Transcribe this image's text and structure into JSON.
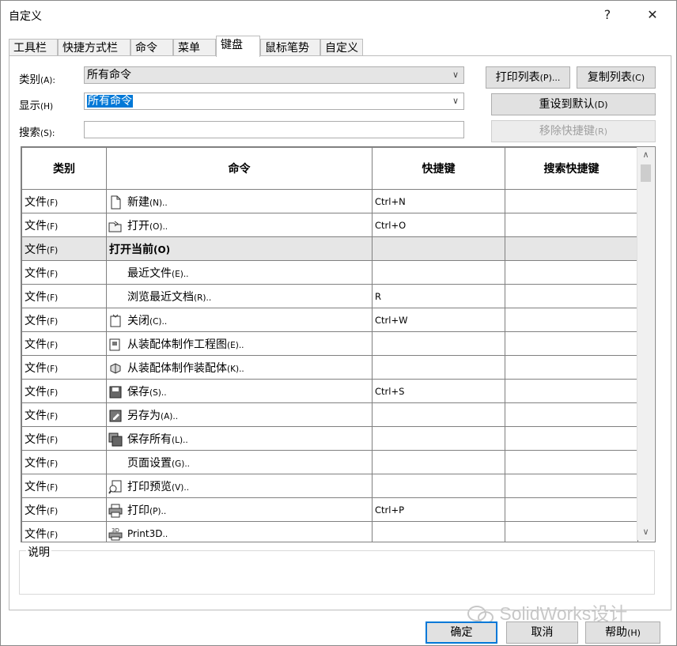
{
  "window": {
    "title": "自定义",
    "help": "?",
    "close": "✕"
  },
  "tabs": [
    "工具栏",
    "快捷方式栏",
    "命令",
    "菜单",
    "键盘",
    "鼠标笔势",
    "自定义"
  ],
  "active_tab": "键盘",
  "filters": {
    "category_label": "类别",
    "category_key": "(A):",
    "category_value": "所有命令",
    "show_label": "显示",
    "show_key": "(H)",
    "show_value": "所有命令",
    "search_label": "搜索",
    "search_key": "(S):",
    "search_value": ""
  },
  "buttons": {
    "print_list": "打印列表",
    "print_list_key": "(P)...",
    "copy_list": "复制列表",
    "copy_list_key": "(C)",
    "reset_default": "重设到默认",
    "reset_default_key": "(D)",
    "remove_shortcut": "移除快捷键",
    "remove_shortcut_key": "(R)",
    "ok": "确定",
    "cancel": "取消",
    "help": "帮助",
    "help_key": "(H)"
  },
  "columns": [
    "类别",
    "命令",
    "快捷键",
    "搜索快捷键"
  ],
  "rows": [
    {
      "cat": "文件",
      "catkey": "(F)",
      "cmd": "新建",
      "cmdkey": "(N)..",
      "key": "Ctrl+N",
      "icon": "new-document-icon"
    },
    {
      "cat": "文件",
      "catkey": "(F)",
      "cmd": "打开",
      "cmdkey": "(O)..",
      "key": "Ctrl+O",
      "icon": "open-folder-icon"
    },
    {
      "cat": "文件",
      "catkey": "(F)",
      "cmd": "打开当前",
      "cmdkey": "(O)",
      "key": "",
      "icon": ""
    },
    {
      "cat": "文件",
      "catkey": "(F)",
      "cmd": "最近文件",
      "cmdkey": "(E)..",
      "key": "",
      "icon": ""
    },
    {
      "cat": "文件",
      "catkey": "(F)",
      "cmd": "浏览最近文档",
      "cmdkey": "(R)..",
      "key": "R",
      "icon": ""
    },
    {
      "cat": "文件",
      "catkey": "(F)",
      "cmd": "关闭",
      "cmdkey": "(C)..",
      "key": "Ctrl+W",
      "icon": "close-document-icon"
    },
    {
      "cat": "文件",
      "catkey": "(F)",
      "cmd": "从装配体制作工程图",
      "cmdkey": "(E)..",
      "key": "",
      "icon": "drawing-from-assembly-icon"
    },
    {
      "cat": "文件",
      "catkey": "(F)",
      "cmd": "从装配体制作装配体",
      "cmdkey": "(K)..",
      "key": "",
      "icon": "assembly-from-assembly-icon"
    },
    {
      "cat": "文件",
      "catkey": "(F)",
      "cmd": "保存",
      "cmdkey": "(S)..",
      "key": "Ctrl+S",
      "icon": "save-icon"
    },
    {
      "cat": "文件",
      "catkey": "(F)",
      "cmd": "另存为",
      "cmdkey": "(A)..",
      "key": "",
      "icon": "save-as-icon"
    },
    {
      "cat": "文件",
      "catkey": "(F)",
      "cmd": "保存所有",
      "cmdkey": "(L)..",
      "key": "",
      "icon": "save-all-icon"
    },
    {
      "cat": "文件",
      "catkey": "(F)",
      "cmd": "页面设置",
      "cmdkey": "(G)..",
      "key": "",
      "icon": ""
    },
    {
      "cat": "文件",
      "catkey": "(F)",
      "cmd": "打印预览",
      "cmdkey": "(V)..",
      "key": "",
      "icon": "print-preview-icon"
    },
    {
      "cat": "文件",
      "catkey": "(F)",
      "cmd": "打印",
      "cmdkey": "(P)..",
      "key": "Ctrl+P",
      "icon": "printer-icon"
    },
    {
      "cat": "文件",
      "catkey": "(F)",
      "cmd": "Print3D",
      "cmdkey": "..",
      "key": "",
      "icon": "print3d-icon"
    }
  ],
  "group_row_index": 2,
  "description_label": "说明",
  "watermark": "SolidWorks设计"
}
